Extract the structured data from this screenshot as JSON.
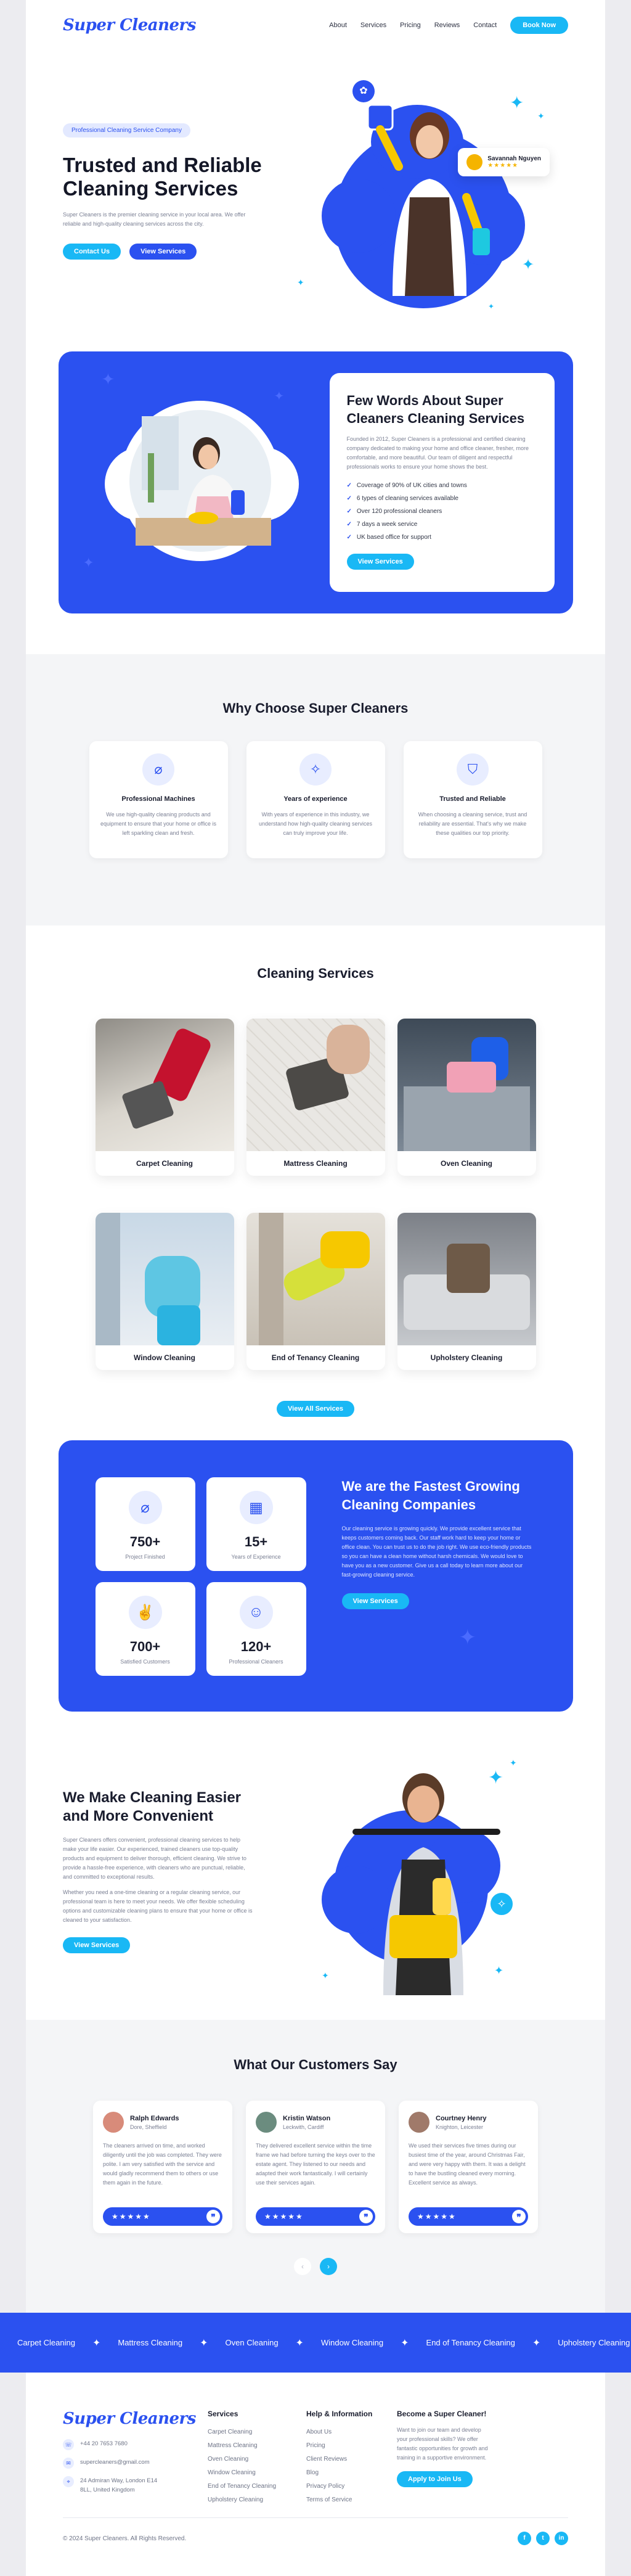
{
  "brand": {
    "logo": "Super Cleaners",
    "primary": "#2b51f0",
    "accent": "#19b8f5"
  },
  "nav": {
    "items": [
      "About",
      "Services",
      "Pricing",
      "Reviews",
      "Contact"
    ],
    "cta": "Book Now"
  },
  "hero": {
    "badge": "Professional Cleaning Service Company",
    "title": "Trusted and Reliable Cleaning Services",
    "description": "Super Cleaners is the premier cleaning service in your local area. We offer reliable and high-quality cleaning services across the city.",
    "btn_contact": "Contact Us",
    "btn_services": "View Services",
    "review": {
      "name": "Savannah Nguyen",
      "stars": "★★★★★"
    }
  },
  "about": {
    "title": "Few Words About Super Cleaners Cleaning Services",
    "description": "Founded in 2012, Super Cleaners is a professional and certified cleaning company dedicated to making your home and office cleaner, fresher, more comfortable, and more beautiful. Our team of diligent and respectful professionals works to ensure your home shows the best.",
    "checklist": [
      "Coverage of 90% of UK cities and towns",
      "6 types of cleaning services available",
      "Over 120 professional cleaners",
      "7 days a week service",
      "UK based office for support"
    ],
    "btn": "View Services"
  },
  "why": {
    "title": "Why Choose Super Cleaners",
    "cards": [
      {
        "icon": "spray-icon",
        "title": "Professional Machines",
        "text": "We use high-quality cleaning products and equipment to ensure that your home or office is left sparkling clean and fresh."
      },
      {
        "icon": "sparkle-icon",
        "title": "Years of experience",
        "text": "With years of experience in this industry, we understand how high-quality cleaning services can truly improve your life."
      },
      {
        "icon": "shield-icon",
        "title": "Trusted and Reliable",
        "text": "When choosing a cleaning service, trust and reliability are essential. That's why we make these qualities our top priority."
      }
    ]
  },
  "services": {
    "title": "Cleaning Services",
    "items": [
      "Carpet Cleaning",
      "Mattress Cleaning",
      "Oven Cleaning",
      "Window Cleaning",
      "End of Tenancy Cleaning",
      "Upholstery Cleaning"
    ],
    "btn": "View All Services"
  },
  "fastest": {
    "stats": [
      {
        "icon": "spray-bottle-icon",
        "value": "750+",
        "label": "Project Finished"
      },
      {
        "icon": "calendar-icon",
        "value": "15+",
        "label": "Years of Experience"
      },
      {
        "icon": "thumbs-up-icon",
        "value": "700+",
        "label": "Satisfied Customers"
      },
      {
        "icon": "cleaner-icon",
        "value": "120+",
        "label": "Professional Cleaners"
      }
    ],
    "title": "We are the Fastest Growing Cleaning Companies",
    "description": "Our cleaning service is growing quickly. We provide excellent service that keeps customers coming back. Our staff work hard to keep your home or office clean. You can trust us to do the job right. We use eco-friendly products so you can have a clean home without harsh chemicals. We would love to have you as a new customer. Give us a call today to learn more about our fast-growing cleaning service.",
    "btn": "View Services"
  },
  "convenient": {
    "title": "We Make Cleaning Easier and More Convenient",
    "p1": "Super Cleaners offers convenient, professional cleaning services to help make your life easier. Our experienced, trained cleaners use top-quality products and equipment to deliver thorough, efficient cleaning. We strive to provide a hassle-free experience, with cleaners who are punctual, reliable, and committed to exceptional results.",
    "p2": "Whether you need a one-time cleaning or a regular cleaning service, our professional team is here to meet your needs. We offer flexible scheduling options and customizable cleaning plans to ensure that your home or office is cleaned to your satisfaction.",
    "btn": "View Services"
  },
  "testimonials": {
    "title": "What Our Customers Say",
    "items": [
      {
        "name": "Ralph Edwards",
        "location": "Dore, Sheffield",
        "text": "The cleaners arrived on time, and worked diligently until the job was completed. They were polite. I am very satisfied with the service and would gladly recommend them to others or use them again in the future.",
        "stars": "★★★★★"
      },
      {
        "name": "Kristin Watson",
        "location": "Leckwith, Cardiff",
        "text": "They delivered excellent service within the time frame we had before turning the keys over to the estate agent. They listened to our needs and adapted their work fantastically. I will certainly use their services again.",
        "stars": "★★★★★"
      },
      {
        "name": "Courtney Henry",
        "location": "Knighton, Leicester",
        "text": "We used their services five times during our busiest time of the year, around Christmas Fair, and were very happy with them. It was a delight to have the bustling cleaned every morning. Excellent service as always.",
        "stars": "★★★★★"
      }
    ]
  },
  "ticker": [
    "Carpet Cleaning",
    "Mattress Cleaning",
    "Oven Cleaning",
    "Window Cleaning",
    "End of Tenancy Cleaning",
    "Upholstery Cleaning"
  ],
  "footer": {
    "logo": "Super Cleaners",
    "phone": "+44 20 7653 7680",
    "email": "supercleaners@gmail.com",
    "address": "24 Admiran Way, London E14 8LL, United Kingdom",
    "services_title": "Services",
    "services": [
      "Carpet Cleaning",
      "Mattress Cleaning",
      "Oven Cleaning",
      "Window Cleaning",
      "End of Tenancy Cleaning",
      "Upholstery Cleaning"
    ],
    "help_title": "Help & Information",
    "help": [
      "About Us",
      "Pricing",
      "Client Reviews",
      "Blog",
      "Privacy Policy",
      "Terms of Service"
    ],
    "join_title": "Become a Super Cleaner!",
    "join_text": "Want to join our team and develop your professional skills? We offer fantastic opportunities for growth and training in a supportive environment.",
    "join_btn": "Apply to Join Us",
    "copyright": "© 2024 Super Cleaners. All Rights Reserved.",
    "socials": [
      "f",
      "t",
      "in"
    ]
  }
}
